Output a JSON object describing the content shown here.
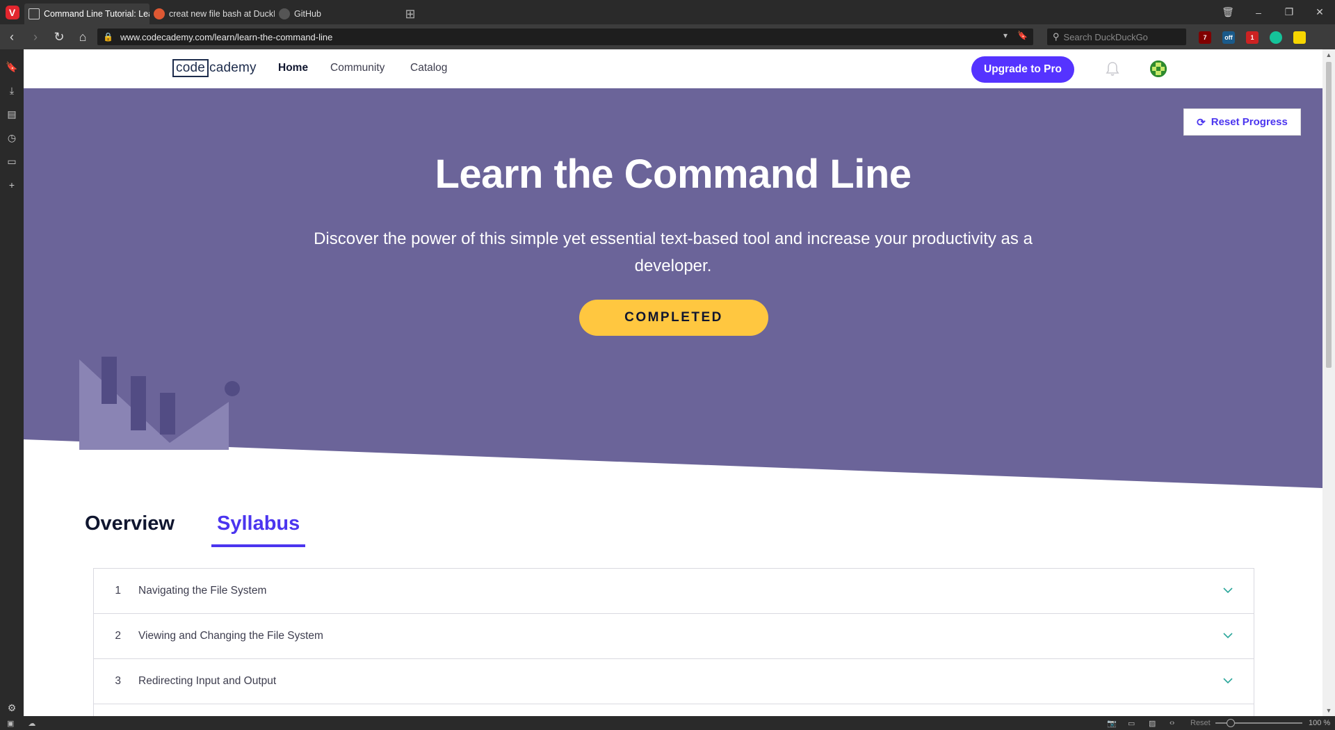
{
  "browser": {
    "tabs": [
      {
        "title": "Command Line Tutorial: Lea",
        "icon": "codecademy-favicon",
        "active": true
      },
      {
        "title": "creat new file bash at DuckD",
        "icon": "duckduckgo-favicon",
        "active": false
      },
      {
        "title": "GitHub",
        "icon": "github-favicon",
        "active": false
      }
    ],
    "url": "www.codecademy.com/learn/learn-the-command-line",
    "search_placeholder": "Search DuckDuckGo",
    "extensions": [
      {
        "name": "ublock-icon",
        "badge": "7",
        "color": "#800000"
      },
      {
        "name": "extension-off-icon",
        "badge": "off",
        "color": "#1a5a8a"
      },
      {
        "name": "lastpass-icon",
        "badge": "1",
        "color": "#cc2222"
      },
      {
        "name": "grammarly-icon",
        "badge": "",
        "color": "#15c39a"
      },
      {
        "name": "toggl-icon",
        "badge": "",
        "color": "#f7d600"
      }
    ],
    "status": {
      "reset_label": "Reset",
      "zoom": "100 %"
    }
  },
  "nav": {
    "logo_box": "code",
    "logo_rest": "cademy",
    "links": [
      "Home",
      "Community",
      "Catalog"
    ],
    "upgrade_label": "Upgrade to Pro"
  },
  "hero": {
    "reset_label": "Reset Progress",
    "title": "Learn the Command Line",
    "subtitle": "Discover the power of this simple yet essential text-based tool and increase your productivity as a developer.",
    "status_label": "COMPLETED",
    "colors": {
      "background": "#6b6499",
      "accent": "#ffc740"
    }
  },
  "page_tabs": [
    "Overview",
    "Syllabus"
  ],
  "syllabus": [
    {
      "num": "1",
      "title": "Navigating the File System"
    },
    {
      "num": "2",
      "title": "Viewing and Changing the File System"
    },
    {
      "num": "3",
      "title": "Redirecting Input and Output"
    }
  ]
}
